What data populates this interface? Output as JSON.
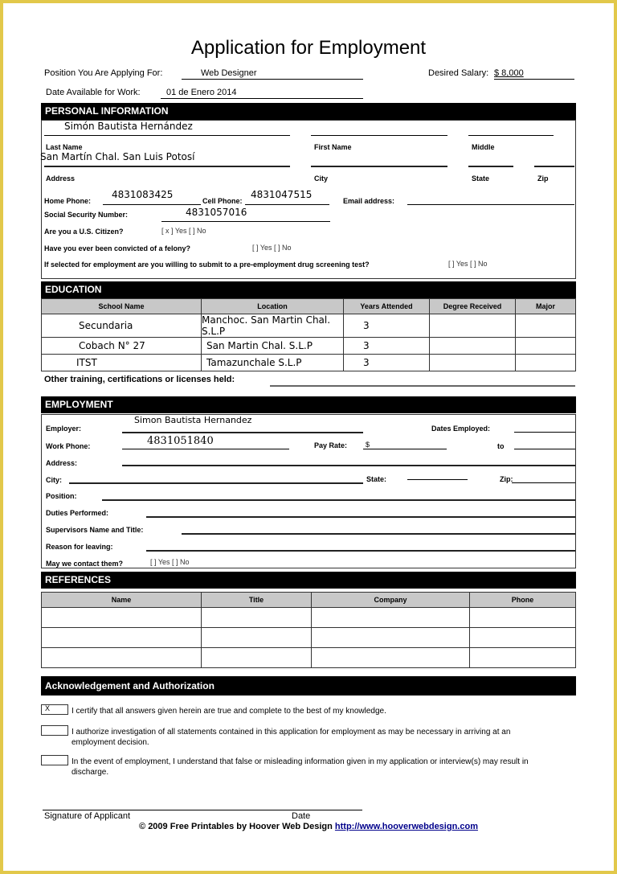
{
  "title": "Application for Employment",
  "header": {
    "position_label": "Position You Are Applying For:",
    "position_value": "Web Designer",
    "salary_label": "Desired Salary:",
    "salary_value": "$ 8,000",
    "date_label": "Date Available for Work:",
    "date_value": "01 de Enero 2014"
  },
  "personal": {
    "section_title": "PERSONAL INFORMATION",
    "name_value": "Simón Bautista Hernández",
    "last_name_label": "Last Name",
    "first_name_label": "First Name",
    "middle_label": "Middle",
    "address_value": "San Martín Chal. San Luis Potosí",
    "address_label": "Address",
    "city_label": "City",
    "state_label": "State",
    "zip_label": "Zip",
    "home_phone_label": "Home Phone:",
    "home_phone_value": "4831083425",
    "cell_phone_label": "Cell Phone:",
    "cell_phone_value": "4831047515",
    "email_label": "Email address:",
    "ssn_label": "Social Security Number:",
    "ssn_value": "4831057016",
    "citizen_label": "Are you a U.S. Citizen?",
    "citizen_value": "[ x ] Yes [  ] No",
    "felony_label": "Have you ever been convicted of a felony?",
    "felony_value": "[  ] Yes [  ] No",
    "drug_label": "If selected for employment are you willing to submit to a pre-employment drug screening test?",
    "drug_value": "[  ] Yes [  ] No"
  },
  "education": {
    "section_title": "EDUCATION",
    "columns": [
      "School Name",
      "Location",
      "Years Attended",
      "Degree Received",
      "Major"
    ],
    "rows": [
      [
        "Secundaria",
        "Manchoc.  San Martin Chal. S.L.P",
        "3",
        "",
        ""
      ],
      [
        "Cobach N° 27",
        "San Martin Chal. S.L.P",
        "3",
        "",
        ""
      ],
      [
        "ITST",
        "Tamazunchale S.L.P",
        "3",
        "",
        ""
      ]
    ],
    "other_training_label": "Other training, certifications or licenses held:"
  },
  "employment": {
    "section_title": "EMPLOYMENT",
    "employer_label": "Employer:",
    "employer_value": "Simon Bautista Hernandez",
    "dates_label": "Dates Employed:",
    "work_phone_label": "Work Phone:",
    "work_phone_value": "4831051840",
    "pay_rate_label": "Pay Rate:",
    "pay_rate_value": "$",
    "to_label": "to",
    "address_label": "Address:",
    "city_label": "City:",
    "state_label": "State:",
    "zip_label": "Zip:",
    "position_label": "Position:",
    "duties_label": "Duties Performed:",
    "supervisor_label": "Supervisors Name and Title:",
    "reason_label": "Reason for leaving:",
    "contact_label": "May we contact them?",
    "contact_value": "[  ]  Yes [  ]  No"
  },
  "references": {
    "section_title": "REFERENCES",
    "columns": [
      "Name",
      "Title",
      "Company",
      "Phone"
    ],
    "rows": [
      [
        "",
        "",
        "",
        ""
      ],
      [
        "",
        "",
        "",
        ""
      ],
      [
        "",
        "",
        "",
        ""
      ]
    ]
  },
  "acknowledgement": {
    "section_title": "Acknowledgement and Authorization",
    "items": [
      {
        "checked_mark": "X",
        "text": "I certify that all answers given herein are true and complete to the best of my knowledge."
      },
      {
        "checked_mark": "",
        "text": "I authorize investigation of all statements contained in this application for employment as may be necessary in arriving at an employment decision."
      },
      {
        "checked_mark": "",
        "text": "In the event of employment, I understand that false or misleading information given in my application or interview(s) may result in discharge."
      }
    ],
    "signature_label": "Signature of  Applicant",
    "date_label": "Date"
  },
  "footer": {
    "copyright": "© 2009 Free Printables by Hoover Web Design",
    "link_text": "http://www.hooverwebdesign.com"
  }
}
